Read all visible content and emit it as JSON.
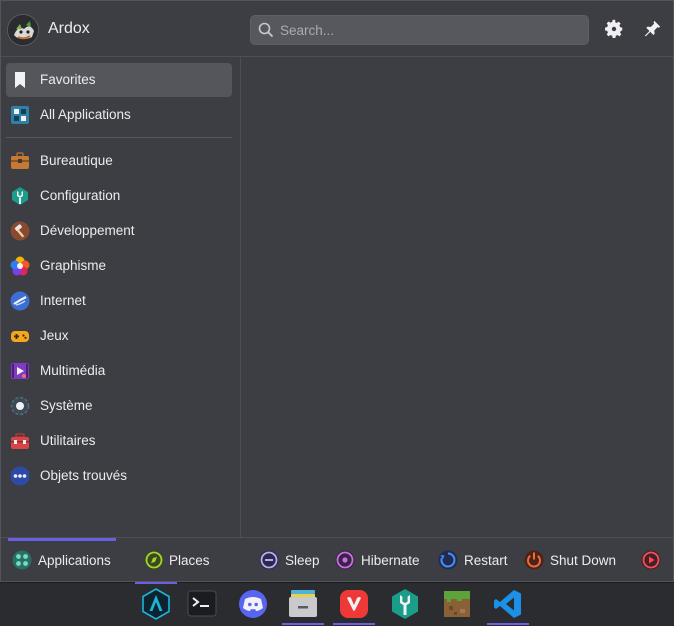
{
  "header": {
    "username": "Ardox",
    "search_placeholder": "Search...",
    "icons": [
      "avatar",
      "search-icon",
      "gear-icon",
      "pin-icon"
    ]
  },
  "sidebar": {
    "items": [
      {
        "label": "Favorites",
        "icon": "bookmark-icon",
        "active": true
      },
      {
        "label": "All Applications",
        "icon": "grid-icon"
      },
      {
        "label": "Bureautique",
        "icon": "briefcase-icon"
      },
      {
        "label": "Configuration",
        "icon": "wrench-icon"
      },
      {
        "label": "Développement",
        "icon": "hammer-icon"
      },
      {
        "label": "Graphisme",
        "icon": "palette-icon"
      },
      {
        "label": "Internet",
        "icon": "globe-icon"
      },
      {
        "label": "Jeux",
        "icon": "gamepad-icon"
      },
      {
        "label": "Multimédia",
        "icon": "media-icon"
      },
      {
        "label": "Système",
        "icon": "system-icon"
      },
      {
        "label": "Utilitaires",
        "icon": "toolbox-icon"
      },
      {
        "label": "Objets trouvés",
        "icon": "dots-icon"
      }
    ]
  },
  "footer": {
    "tabs": [
      {
        "label": "Applications",
        "icon": "applications-icon",
        "active": true
      },
      {
        "label": "Places",
        "icon": "compass-icon"
      }
    ],
    "actions": [
      {
        "label": "Sleep",
        "icon": "sleep-icon"
      },
      {
        "label": "Hibernate",
        "icon": "hibernate-icon"
      },
      {
        "label": "Restart",
        "icon": "restart-icon"
      },
      {
        "label": "Shut Down",
        "icon": "shutdown-icon"
      },
      {
        "label": "",
        "icon": "leave-icon"
      }
    ]
  },
  "taskbar": {
    "apps": [
      {
        "icon": "arch-launcher-icon",
        "active": true
      },
      {
        "icon": "terminal-icon"
      },
      {
        "icon": "discord-icon"
      },
      {
        "icon": "file-manager-icon",
        "active": true
      },
      {
        "icon": "vivaldi-icon",
        "active": true
      },
      {
        "icon": "settings-wrench-icon"
      },
      {
        "icon": "minecraft-icon"
      },
      {
        "icon": "vscode-icon",
        "active": true
      }
    ]
  },
  "colors": {
    "panel_bg": "#3d3e43",
    "taskbar_bg": "#2a2c30",
    "accent": "#6a5fe0",
    "active_item_bg": "#55565c"
  }
}
